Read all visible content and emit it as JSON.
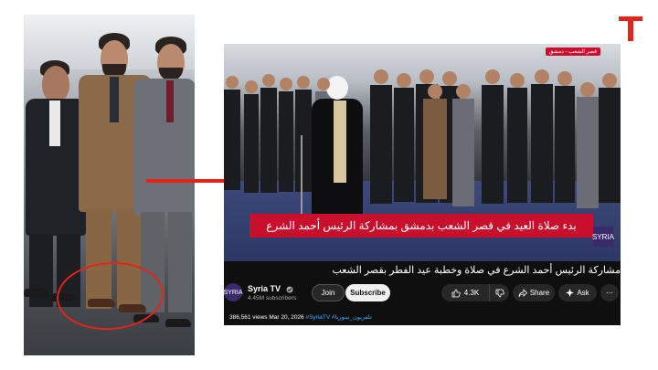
{
  "brand": {
    "logo_letter": "T",
    "color": "#e3241b"
  },
  "left_panel": {
    "circle_color": "#e3241b"
  },
  "arrow": {
    "color": "#e3241b"
  },
  "video": {
    "channel_badge": "قصر الشعب - دمشق",
    "lower_third": "بدء صلاة العيد في قصر الشعب بدمشق بمشاركة الرئيس أحمد الشرع",
    "lower_third_logo": "SYRIA",
    "title": "مشاركة الرئيس أحمد الشرع في صلاة وخطبة عيد الفطر بقصر الشعب"
  },
  "channel": {
    "avatar_text": "SYRIA",
    "name": "Syria TV",
    "verified_icon": "verified-check-icon",
    "subscribers": "4.45M subscribers"
  },
  "actions": {
    "join": "Join",
    "subscribe": "Subscribe",
    "likes": "4.3K",
    "share": "Share",
    "ask": "Ask",
    "more": "⋯"
  },
  "meta": {
    "views_date": "386,561 views  Mar 20, 2026",
    "tags": "#SyriaTV #تلفزيون_سوريا"
  },
  "colors": {
    "accent_red": "#c8102e",
    "yt_bg": "#0f0f0f",
    "link_blue": "#3ea6ff"
  }
}
